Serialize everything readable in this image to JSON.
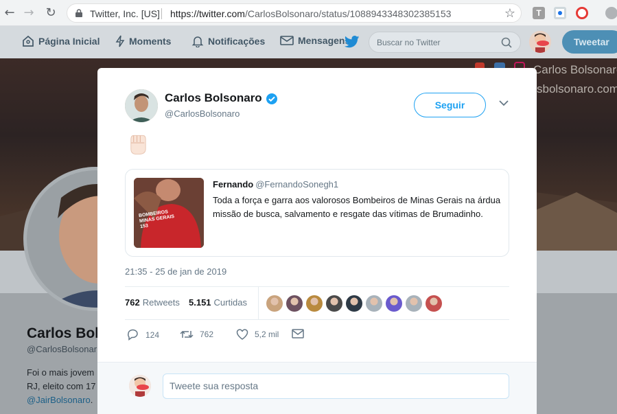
{
  "browser": {
    "org": "Twitter, Inc. [US]",
    "url_host": "https://twitter.com",
    "url_path": "/CarlosBolsonaro/status/1088943348302385153"
  },
  "topbar": {
    "nav": [
      {
        "label": "Página Inicial",
        "icon": "home-icon"
      },
      {
        "label": "Moments",
        "icon": "lightning-icon"
      },
      {
        "label": "Notificações",
        "icon": "bell-icon"
      },
      {
        "label": "Mensagens",
        "icon": "envelope-icon"
      }
    ],
    "search_placeholder": "Buscar no Twitter",
    "tweet_button": "Tweetar"
  },
  "background_profile": {
    "banner_line1": "Carlos Bolsonaro",
    "banner_line2": "sbolsonaro.com",
    "name": "Carlos Bols",
    "handle": "@CarlosBolsonar",
    "bio_line1": "Foi o mais jovem",
    "bio_line2": "RJ, eleito com 17",
    "bio_link": "@JairBolsonaro"
  },
  "tweet": {
    "author_name": "Carlos Bolsonaro",
    "author_handle": "@CarlosBolsonaro",
    "follow_label": "Seguir",
    "timestamp": "21:35 - 25 de jan de 2019",
    "quote": {
      "author_name": "Fernando",
      "author_handle": "@FernandoSonegh1",
      "text": "Toda a força e garra aos valorosos Bombeiros de Minas Gerais na árdua missão de busca, salvamento e resgate das vítimas de Brumadinho.",
      "image_text": "BOMBEIROS MINAS GERAIS 153"
    },
    "stats": {
      "retweets_count": "762",
      "retweets_label": "Retweets",
      "likes_count": "5.151",
      "likes_label": "Curtidas"
    },
    "likers_colors": [
      "#c9a37d",
      "#6d5160",
      "#b98a3e",
      "#4a4a4a",
      "#2e3a46",
      "#a8b2ba",
      "#6a5acd",
      "#a8b2ba",
      "#c5504f"
    ],
    "actions": {
      "replies": "124",
      "retweets": "762",
      "likes": "5,2 mil"
    },
    "reply_placeholder": "Tweete sua resposta"
  }
}
